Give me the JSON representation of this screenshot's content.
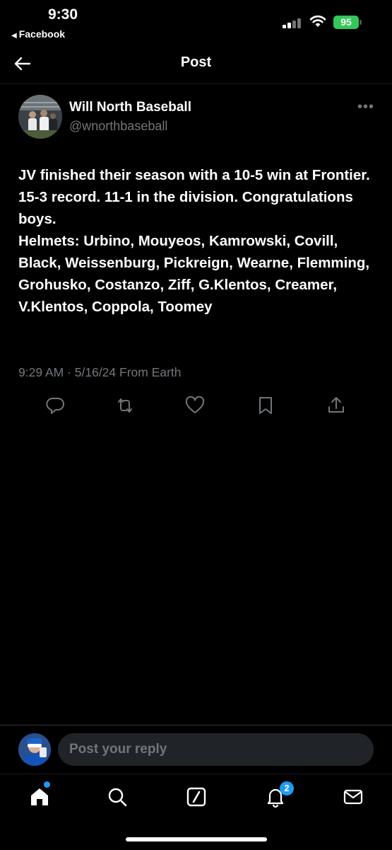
{
  "status_bar": {
    "time": "9:30",
    "back_app": "Facebook",
    "battery": "95"
  },
  "header": {
    "title": "Post"
  },
  "post": {
    "author_name": "Will North Baseball",
    "author_handle": "@wnorthbaseball",
    "text": "JV finished their season with a 10-5 win at Frontier. 15-3 record. 11-1 in the division. Congratulations boys.\nHelmets: Urbino, Mouyeos, Kamrowski, Covill, Black, Weissenburg, Pickreign, Wearne, Flemming, Grohusko, Costanzo, Ziff, G.Klentos, Creamer, V.Klentos, Coppola, Toomey",
    "meta": "9:29 AM · 5/16/24 From Earth"
  },
  "actions": [
    "reply-icon",
    "repost-icon",
    "like-icon",
    "bookmark-icon",
    "share-icon"
  ],
  "reply": {
    "placeholder": "Post your reply"
  },
  "tabbar": {
    "notifications_badge": "2"
  },
  "colors": {
    "background": "#000000",
    "text": "#e7e9ea",
    "muted": "#71767b",
    "accent": "#1d9bf0",
    "battery": "#34c759"
  }
}
